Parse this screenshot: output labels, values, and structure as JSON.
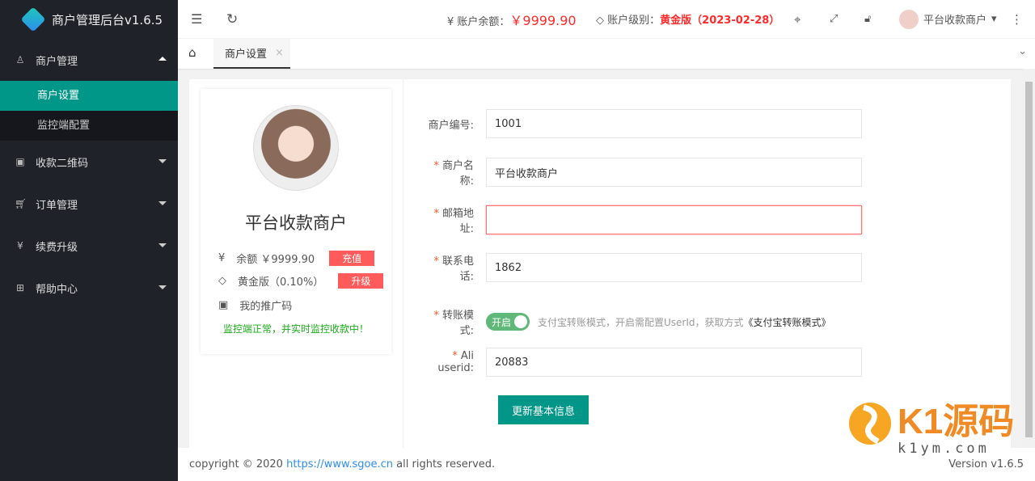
{
  "app": {
    "title": "商户管理后台v1.6.5"
  },
  "sidebar": {
    "items": [
      {
        "label": "商户管理",
        "icon": "user-icon",
        "expanded": true,
        "children": [
          {
            "label": "商户设置",
            "active": true
          },
          {
            "label": "监控端配置"
          }
        ]
      },
      {
        "label": "收款二维码",
        "icon": "image-icon"
      },
      {
        "label": "订单管理",
        "icon": "cart-icon"
      },
      {
        "label": "续费升级",
        "icon": "yen-icon"
      },
      {
        "label": "帮助中心",
        "icon": "apps-icon"
      }
    ]
  },
  "header": {
    "balance_label": "账户余额：",
    "balance": "￥9999.90",
    "level_label": "账户级别：",
    "level": "黄金版（2023-02-28）",
    "user": "平台收款商户"
  },
  "tabs": [
    {
      "label": "商户设置",
      "close": "×"
    }
  ],
  "profile": {
    "name": "平台收款商户",
    "balance_text": "余额 ￥9999.90",
    "recharge": "充值",
    "level_text": "黄金版（0.10%）",
    "upgrade": "升级",
    "promo": "我的推广码",
    "status": "监控端正常，并实时监控收款中！"
  },
  "form": {
    "merchant_id": {
      "label": "商户编号:",
      "value": "1001"
    },
    "merchant_name": {
      "label": "商户名称:",
      "value": "平台收款商户"
    },
    "email": {
      "label": "邮箱地址:",
      "value": ""
    },
    "phone": {
      "label": "联系电话:",
      "value": "1862"
    },
    "transfer_mode": {
      "label": "转账模式:",
      "toggle": "开启",
      "on": true,
      "hint": "支付宝转账模式，开启需配置UserId，获取方式",
      "link": "《支付宝转账模式》"
    },
    "ali_userid": {
      "label": "Ali userid:",
      "value": "20883"
    },
    "submit": "更新基本信息",
    "required_mark": "*"
  },
  "footer": {
    "copyright": "copyright © 2020",
    "link": "https://www.sgoe.cn",
    "rights": "all rights reserved.",
    "version": "Version v1.6.5"
  },
  "watermark": {
    "text": "K1源码",
    "url": "k1ym.com"
  },
  "colors": {
    "accent": "#009688",
    "danger": "#ff2a2a",
    "badge": "#ff5b5b",
    "success": "#1aad19"
  }
}
